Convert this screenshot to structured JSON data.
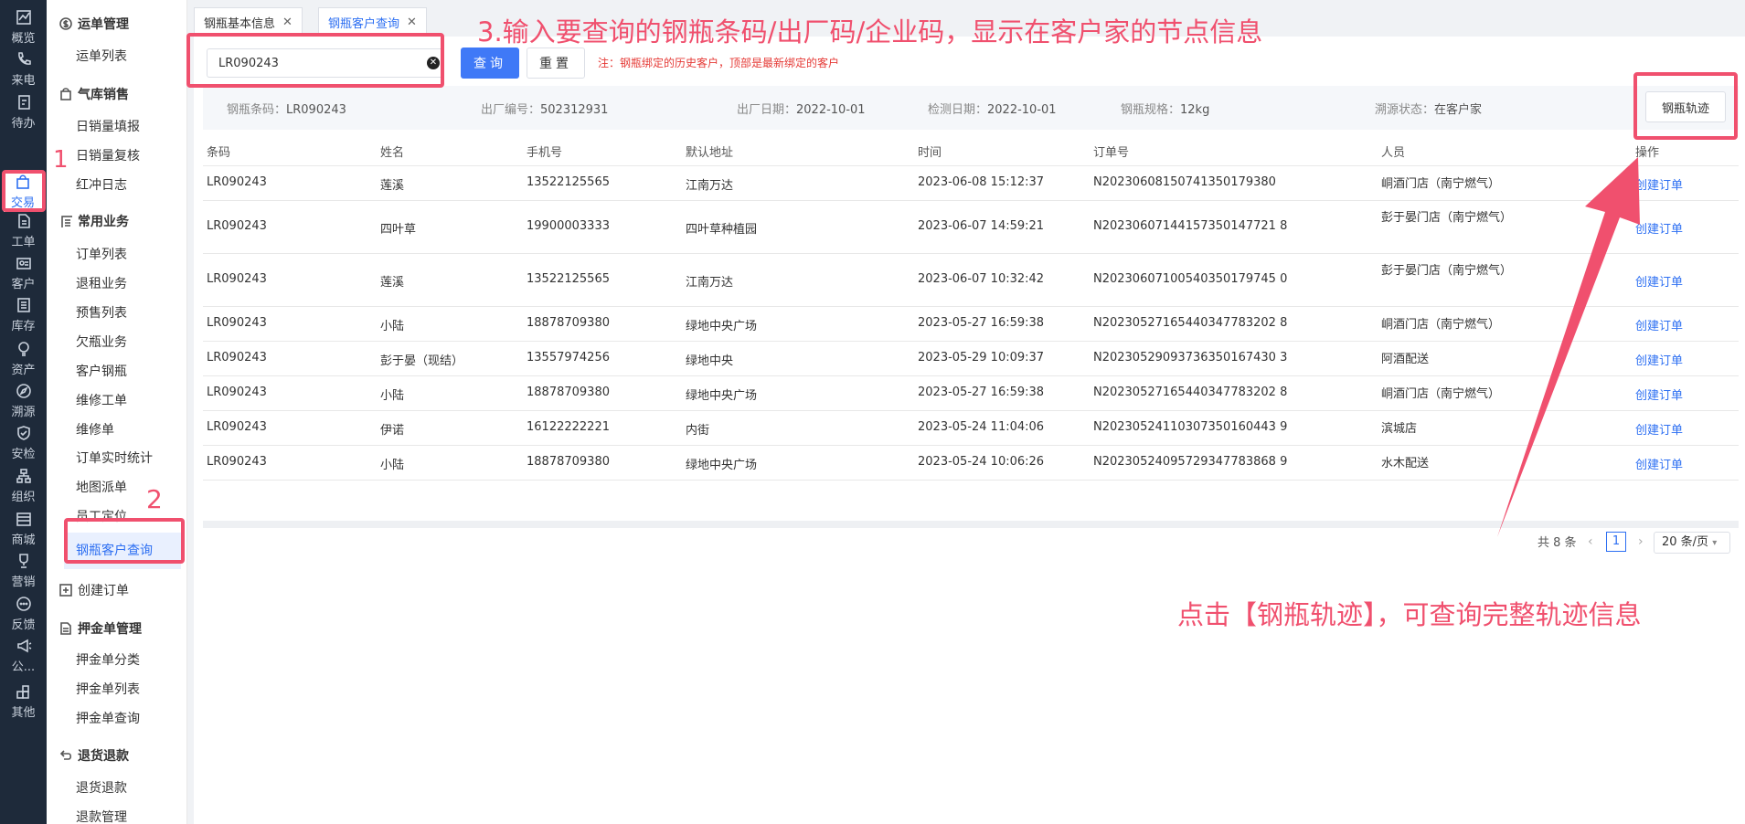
{
  "rail": [
    {
      "label": "概览",
      "icon": "chart-icon"
    },
    {
      "label": "来电",
      "icon": "phone-icon"
    },
    {
      "label": "待办",
      "icon": "clipboard-icon"
    },
    {
      "label": "交易",
      "icon": "shopping-bag-icon",
      "active": true
    },
    {
      "label": "工单",
      "icon": "document-icon"
    },
    {
      "label": "客户",
      "icon": "id-card-icon"
    },
    {
      "label": "库存",
      "icon": "list-icon"
    },
    {
      "label": "资产",
      "icon": "bulb-icon"
    },
    {
      "label": "溯源",
      "icon": "compass-icon"
    },
    {
      "label": "安检",
      "icon": "shield-icon"
    },
    {
      "label": "组织",
      "icon": "org-icon"
    },
    {
      "label": "商城",
      "icon": "store-icon"
    },
    {
      "label": "营销",
      "icon": "trophy-icon"
    },
    {
      "label": "反馈",
      "icon": "chat-icon"
    },
    {
      "label": "公...",
      "icon": "megaphone-icon"
    },
    {
      "label": "其他",
      "icon": "apps-icon"
    }
  ],
  "submenu": {
    "groups": [
      {
        "title": "运单管理",
        "icon": "dollar-icon",
        "items": [
          "运单列表"
        ]
      },
      {
        "title": "气库销售",
        "icon": "bag-icon",
        "items": [
          "日销量填报",
          "日销量复核",
          "红冲日志"
        ]
      },
      {
        "title": "常用业务",
        "icon": "list-icon",
        "items": [
          "订单列表",
          "退租业务",
          "预售列表",
          "欠瓶业务",
          "客户钢瓶",
          "维修工单",
          "维修单",
          "订单实时统计",
          "地图派单",
          "员工定位",
          "钢瓶客户查询"
        ]
      },
      {
        "title": "创建订单",
        "icon": "plus-icon",
        "items": []
      },
      {
        "title": "押金单管理",
        "icon": "doc-icon",
        "items": [
          "押金单分类",
          "押金单列表",
          "押金单查询"
        ]
      },
      {
        "title": "退货退款",
        "icon": "return-icon",
        "items": [
          "退货退款",
          "退款管理"
        ]
      }
    ],
    "active_item": "钢瓶客户查询"
  },
  "tabs": [
    {
      "label": "钢瓶基本信息"
    },
    {
      "label": "钢瓶客户查询",
      "active": true
    }
  ],
  "search": {
    "value": "LR090243",
    "query_label": "查询",
    "reset_label": "重置",
    "note": "注：钢瓶绑定的历史客户，顶部是最新绑定的客户"
  },
  "info": [
    {
      "label": "钢瓶条码：",
      "value": "LR090243"
    },
    {
      "label": "出厂编号：",
      "value": "502312931"
    },
    {
      "label": "出厂日期：",
      "value": "2022-10-01"
    },
    {
      "label": "检测日期：",
      "value": "2022-10-01"
    },
    {
      "label": "钢瓶规格：",
      "value": "12kg"
    },
    {
      "label": "溯源状态：",
      "value": "在客户家"
    }
  ],
  "track_button": "钢瓶轨迹",
  "table": {
    "headers": [
      "条码",
      "姓名",
      "手机号",
      "默认地址",
      "时间",
      "订单号",
      "人员",
      "操作"
    ],
    "rows": [
      [
        "LR090243",
        "莲溪",
        "13522125565",
        "江南万达",
        "2023-06-08 15:12:37",
        "N20230608150741350179380",
        "峒酒门店（南宁燃气）",
        "创建订单"
      ],
      [
        "LR090243",
        "四叶草",
        "19900003333",
        "四叶草种植园",
        "2023-06-07 14:59:21",
        "N20230607144157350147721 8",
        "彭于晏门店（南宁燃气）",
        "创建订单"
      ],
      [
        "LR090243",
        "莲溪",
        "13522125565",
        "江南万达",
        "2023-06-07 10:32:42",
        "N20230607100540350179745 0",
        "彭于晏门店（南宁燃气）",
        "创建订单"
      ],
      [
        "LR090243",
        "小陆",
        "18878709380",
        "绿地中央广场",
        "2023-05-27 16:59:38",
        "N20230527165440347783202 8",
        "峒酒门店（南宁燃气）",
        "创建订单"
      ],
      [
        "LR090243",
        "彭于晏（现结）",
        "13557974256",
        "绿地中央",
        "2023-05-29 10:09:37",
        "N20230529093736350167430 3",
        "阿酒配送",
        "创建订单"
      ],
      [
        "LR090243",
        "小陆",
        "18878709380",
        "绿地中央广场",
        "2023-05-27 16:59:38",
        "N20230527165440347783202 8",
        "峒酒门店（南宁燃气）",
        "创建订单"
      ],
      [
        "LR090243",
        "伊诺",
        "16122222221",
        "内街",
        "2023-05-24 11:04:06",
        "N20230524110307350160443 9",
        "滨城店",
        "创建订单"
      ],
      [
        "LR090243",
        "小陆",
        "18878709380",
        "绿地中央广场",
        "2023-05-24 10:06:26",
        "N20230524095729347783868 9",
        "水木配送",
        "创建订单"
      ]
    ]
  },
  "pager": {
    "total": "共 8 条",
    "page": "1",
    "size": "20 条/页"
  },
  "annotations": {
    "n1": "1",
    "n2": "2",
    "step3": "3.输入要查询的钢瓶条码/出厂码/企业码，显示在客户家的节点信息",
    "track_tip": "点击【钢瓶轨迹】，可查询完整轨迹信息"
  },
  "colors": {
    "accent": "#2d6ff2",
    "annotation": "#f0506e",
    "rail": "#1e2a3a"
  }
}
